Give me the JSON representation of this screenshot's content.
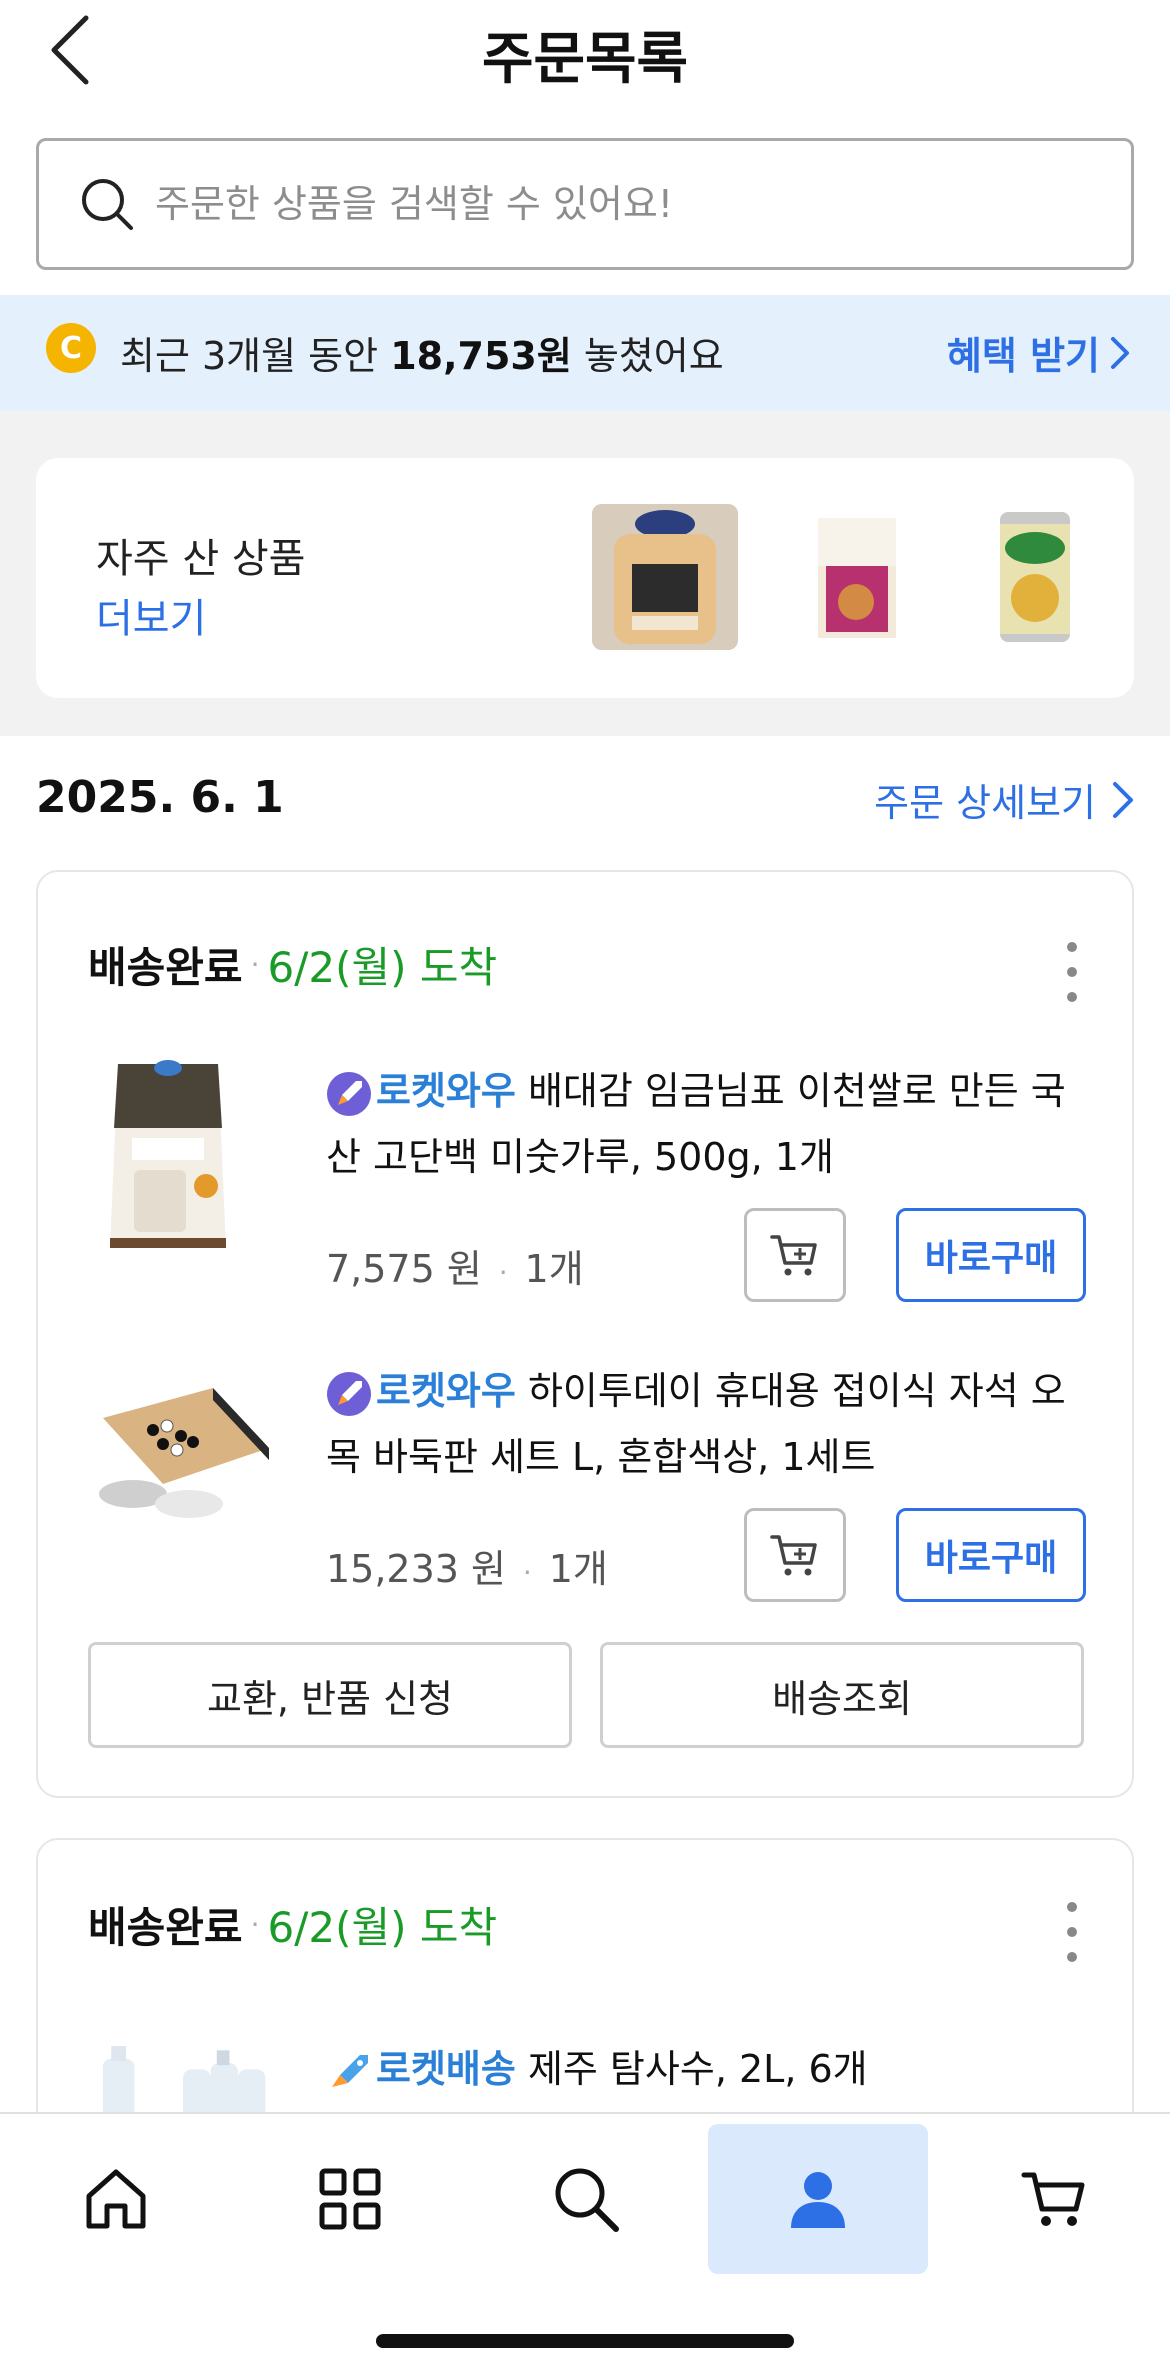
{
  "header": {
    "title": "주문목록"
  },
  "search": {
    "placeholder": "주문한 상품을 검색할 수 있어요!"
  },
  "promo": {
    "coin_letter": "C",
    "text_prefix": "최근 3개월 동안 ",
    "amount": "18,753원",
    "text_suffix": " 놓쳤어요",
    "link_label": "혜택 받기"
  },
  "frequent": {
    "title": "자주 산 상품",
    "more_label": "더보기",
    "thumbs": [
      "bread-product-image",
      "cereal-product-image",
      "canned-corn-product-image"
    ]
  },
  "order": {
    "date": "2025. 6. 1",
    "detail_link": "주문 상세보기",
    "groups": [
      {
        "status": "배송완료",
        "sep": "·",
        "arrival": "6/2(월) 도착",
        "items": [
          {
            "badge": "로켓와우",
            "name": "배대감 임금님표 이천쌀로 만든 국산 고단백 미숫가루, 500g, 1개",
            "price": "7,575 원",
            "qty": "1개",
            "buy_label": "바로구매"
          },
          {
            "badge": "로켓와우",
            "name": "하이투데이 휴대용 접이식 자석 오목 바둑판 세트 L, 혼합색상, 1세트",
            "price": "15,233 원",
            "qty": "1개",
            "buy_label": "바로구매"
          }
        ],
        "actions": [
          "교환, 반품 신청",
          "배송조회"
        ]
      },
      {
        "status": "배송완료",
        "sep": "·",
        "arrival": "6/2(월) 도착",
        "items": [
          {
            "badge": "로켓배송",
            "name": "제주 탐사수, 2L, 6개"
          }
        ]
      }
    ]
  },
  "nav": {
    "items": [
      "home-icon",
      "categories-icon",
      "search-icon",
      "my-page-icon",
      "cart-icon"
    ],
    "active": "my-page-icon"
  },
  "colors": {
    "accent": "#2d6fe5",
    "arrival": "#1a9b28",
    "promo_bg": "#e5f0fd",
    "coin": "#f5b400",
    "badge": "#2a7fd6"
  }
}
